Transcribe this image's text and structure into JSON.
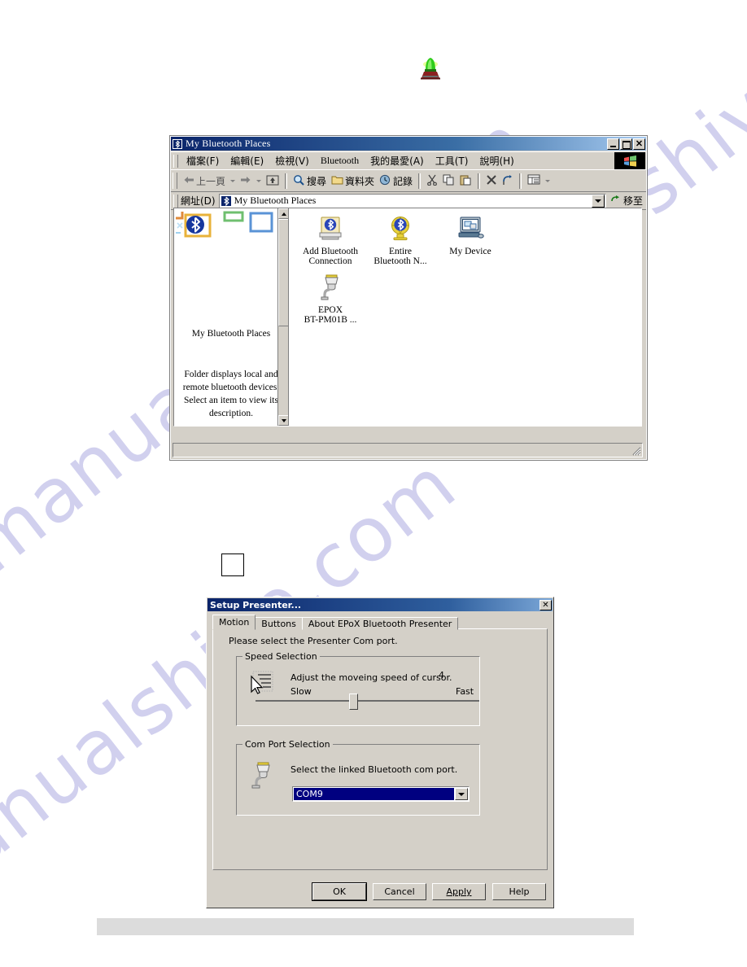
{
  "page": {
    "beacon_icon": "green-beacon-light-icon",
    "watermark_text": "manualshive.com"
  },
  "explorer": {
    "title": "My Bluetooth Places",
    "title_icon": "bluetooth-icon",
    "window_buttons": {
      "minimize": "minimize-button",
      "maximize": "maximize-button",
      "close": "close-button",
      "close_glyph": "✕"
    },
    "menu": [
      {
        "label": "檔案(F)",
        "lat": false
      },
      {
        "label": "編輯(E)",
        "lat": false
      },
      {
        "label": "檢視(V)",
        "lat": false
      },
      {
        "label": "Bluetooth",
        "lat": true
      },
      {
        "label": "我的最愛(A)",
        "lat": false
      },
      {
        "label": "工具(T)",
        "lat": false
      },
      {
        "label": "說明(H)",
        "lat": false
      }
    ],
    "toolbar": [
      {
        "name": "back-button",
        "label": "上一頁",
        "icon": "back-arrow-icon",
        "enabled": false,
        "dropdown": true
      },
      {
        "name": "forward-button",
        "label": "",
        "icon": "forward-arrow-icon",
        "enabled": false,
        "dropdown": true
      },
      {
        "name": "up-button",
        "label": "",
        "icon": "up-folder-icon",
        "enabled": true,
        "dropdown": false
      },
      {
        "name": "search-button",
        "label": "搜尋",
        "icon": "search-icon",
        "enabled": true,
        "dropdown": false
      },
      {
        "name": "folders-button",
        "label": "資料夾",
        "icon": "folders-icon",
        "enabled": true,
        "dropdown": false
      },
      {
        "name": "history-button",
        "label": "記錄",
        "icon": "history-icon",
        "enabled": true,
        "dropdown": false
      },
      {
        "name": "cut-button",
        "label": "",
        "icon": "scissors-icon",
        "enabled": true,
        "dropdown": false
      },
      {
        "name": "copy-button",
        "label": "",
        "icon": "copy-icon",
        "enabled": true,
        "dropdown": false
      },
      {
        "name": "paste-button",
        "label": "",
        "icon": "paste-icon",
        "enabled": true,
        "dropdown": false
      },
      {
        "name": "delete-button",
        "label": "",
        "icon": "delete-x-icon",
        "enabled": true,
        "dropdown": false
      },
      {
        "name": "undo-button",
        "label": "",
        "icon": "undo-icon",
        "enabled": true,
        "dropdown": false
      },
      {
        "name": "views-button",
        "label": "",
        "icon": "views-icon",
        "enabled": true,
        "dropdown": true
      }
    ],
    "address": {
      "label": "網址(D)",
      "value": "My Bluetooth Places",
      "icon": "bluetooth-icon",
      "go_label": "移至",
      "go_icon": "go-arrow-icon"
    },
    "left_pane": {
      "banner_icon": "bluetooth-banner-icon",
      "title": "My Bluetooth Places",
      "description": "Folder displays local and remote bluetooth devices. Select an item to view its description."
    },
    "items": [
      {
        "name": "add-bluetooth-connection",
        "label_line1": "Add Bluetooth",
        "label_line2": "Connection",
        "icon": "add-bluetooth-connection-icon"
      },
      {
        "name": "entire-bluetooth-network",
        "label_line1": "Entire",
        "label_line2": "Bluetooth N...",
        "icon": "entire-bluetooth-network-icon"
      },
      {
        "name": "my-device",
        "label_line1": "My Device",
        "label_line2": "",
        "icon": "my-device-computer-icon"
      },
      {
        "name": "epox-bt-pm01b",
        "label_line1": "EPOX",
        "label_line2": "BT-PM01B ...",
        "icon": "bluetooth-serial-port-icon"
      }
    ],
    "statusbar_text": ""
  },
  "presenter": {
    "title": "Setup Presenter...",
    "close_glyph": "✕",
    "tabs": [
      {
        "label": "Motion",
        "active": true
      },
      {
        "label": "Buttons",
        "active": false
      },
      {
        "label": "About EPoX Bluetooth Presenter",
        "active": false
      }
    ],
    "hint": "Please select the Presenter Com port.",
    "speed_group": {
      "legend": "Speed Selection",
      "icon": "cursor-speed-icon",
      "description": "Adjust the moveing speed of cursor.",
      "value": "4",
      "min_label": "Slow",
      "max_label": "Fast",
      "slider_position_percent": 42
    },
    "com_group": {
      "legend": "Com Port Selection",
      "icon": "com-port-plug-icon",
      "description": "Select the linked Bluetooth com port.",
      "selected_value": "COM9",
      "dropdown_icon": "chevron-down-icon"
    },
    "buttons": [
      {
        "name": "ok-button",
        "label": "OK",
        "default": true,
        "accel": ""
      },
      {
        "name": "cancel-button",
        "label": "Cancel",
        "default": false,
        "accel": ""
      },
      {
        "name": "apply-button",
        "label": "Apply",
        "default": false,
        "accel": "A"
      },
      {
        "name": "help-button",
        "label": "Help",
        "default": false,
        "accel": ""
      }
    ]
  }
}
